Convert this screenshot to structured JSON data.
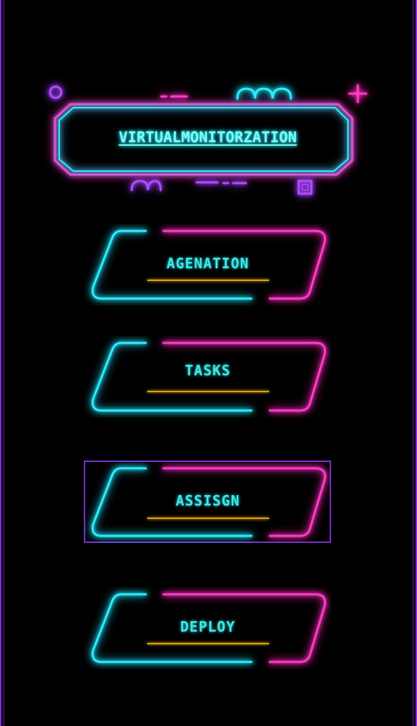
{
  "title": "VIRTUALMONITORZATION",
  "buttons": [
    {
      "id": "agenation",
      "label": "AGENATION"
    },
    {
      "id": "tasks",
      "label": "TASKS"
    },
    {
      "id": "assisgn",
      "label": "ASSISGN",
      "selected": true
    },
    {
      "id": "deploy",
      "label": "DEPLOY"
    }
  ],
  "colors": {
    "background": "#000000",
    "frame": "#8a2be2",
    "neon_cyan": "#29f0ff",
    "neon_pink": "#ff3cc8",
    "neon_purple": "#b04bff",
    "label": "#3fe6e6",
    "underline": "#e6a200",
    "selection": "#7b2ed6"
  }
}
